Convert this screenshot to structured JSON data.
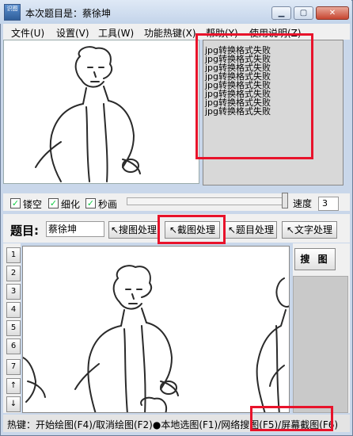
{
  "window": {
    "title": "本次题目是：蔡徐坤",
    "icon_text": "识图"
  },
  "menu": [
    "文件(U)",
    "设置(V)",
    "工具(W)",
    "功能热键(X)",
    "帮助(Y)",
    "使用说明(Z)"
  ],
  "log": {
    "lines": [
      "jpg转换格式失败",
      "jpg转换格式失败",
      "jpg转换格式失败",
      "jpg转换格式失败",
      "jpg转换格式失败",
      "jpg转换格式失败",
      "jpg转换格式失败",
      "jpg转换格式失败"
    ]
  },
  "options": {
    "hollow": {
      "label": "镂空",
      "checked": true
    },
    "thin": {
      "label": "细化",
      "checked": true
    },
    "second_draw": {
      "label": "秒画",
      "checked": true
    },
    "speed_label": "速度",
    "speed_value": "3"
  },
  "question": {
    "label": "题目:",
    "value": "蔡徐坤"
  },
  "buttons": {
    "search_process": "↖搜图处理",
    "capture_process": "↖截图处理",
    "topic_process": "↖题目处理",
    "text_process": "↖文字处理",
    "search": "搜 图"
  },
  "side_buttons": [
    "1",
    "2",
    "3",
    "4",
    "5",
    "6",
    "7",
    "↑",
    "↓"
  ],
  "status_bar": "热键：开始绘图(F4)/取消绘图(F2)●本地选图(F1)/网络搜图(F5)/屏幕截图(F6)",
  "colors": {
    "highlight": "#e8132b",
    "window_frame": "#c9d7ea"
  }
}
